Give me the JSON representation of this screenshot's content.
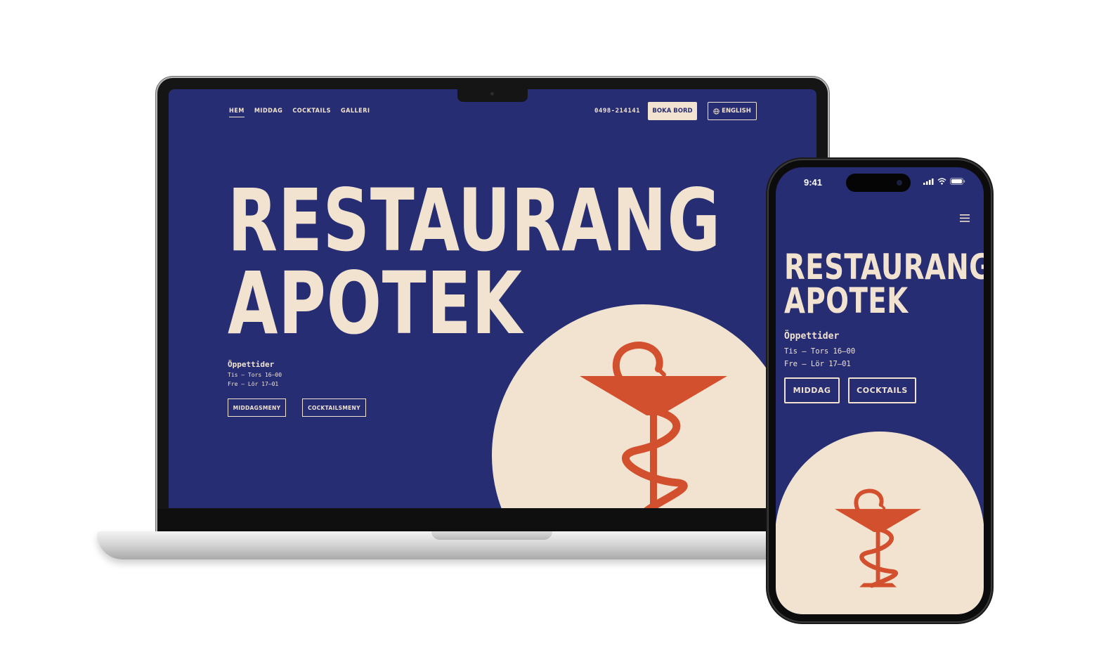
{
  "colors": {
    "navy": "#272d73",
    "cream": "#f1e3d0",
    "orange": "#d3502e"
  },
  "desktop": {
    "nav": [
      {
        "label": "HEM",
        "active": true
      },
      {
        "label": "MIDDAG",
        "active": false
      },
      {
        "label": "COCKTAILS",
        "active": false
      },
      {
        "label": "GALLERI",
        "active": false
      }
    ],
    "phone_number": "0498-214141",
    "book_label": "BOKA BORD",
    "language_label": "ENGLISH",
    "title_line1": "RESTAURANG",
    "title_line2": "APOTEK",
    "hours_heading": "Öppettider",
    "hours": [
      "Tis – Tors 16–00",
      "Fre – Lör 17–01"
    ],
    "buttons": {
      "dinner": "MIDDAGSMENY",
      "cocktails": "COCKTAILSMENY"
    },
    "icons": {
      "language": "globe-icon",
      "hero_symbol": "bowl-of-hygieia-icon"
    }
  },
  "mobile": {
    "status_time": "9:41",
    "title_line1": "RESTAURANG",
    "title_line2": "APOTEK",
    "hours_heading": "Öppettider",
    "hours": [
      "Tis – Tors 16–00",
      "Fre – Lör 17–01"
    ],
    "buttons": {
      "dinner": "MIDDAG",
      "cocktails": "COCKTAILS"
    },
    "icons": {
      "menu": "hamburger-menu-icon",
      "signal": "signal-icon",
      "wifi": "wifi-icon",
      "battery": "battery-icon"
    }
  }
}
